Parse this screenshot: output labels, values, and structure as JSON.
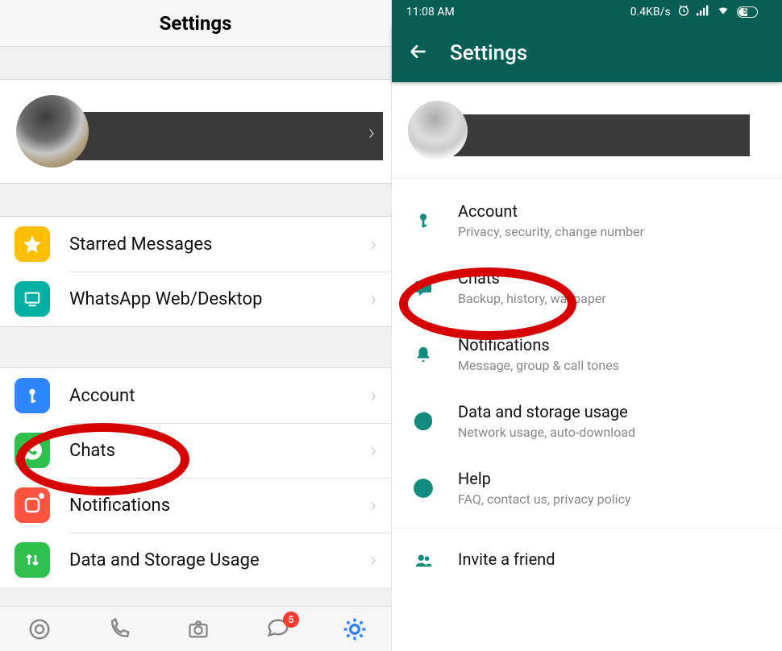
{
  "ios": {
    "title": "Settings",
    "group1": [
      {
        "label": "Starred Messages"
      },
      {
        "label": "WhatsApp Web/Desktop"
      }
    ],
    "group2": [
      {
        "label": "Account"
      },
      {
        "label": "Chats"
      },
      {
        "label": "Notifications"
      },
      {
        "label": "Data and Storage Usage"
      }
    ],
    "tab_badge": "5"
  },
  "android": {
    "status": {
      "time": "11:08 AM",
      "speed": "0.4KB/s",
      "battery": "51"
    },
    "title": "Settings",
    "items": [
      {
        "title": "Account",
        "subtitle": "Privacy, security, change number"
      },
      {
        "title": "Chats",
        "subtitle": "Backup, history, wallpaper"
      },
      {
        "title": "Notifications",
        "subtitle": "Message, group & call tones"
      },
      {
        "title": "Data and storage usage",
        "subtitle": "Network usage, auto-download"
      },
      {
        "title": "Help",
        "subtitle": "FAQ, contact us, privacy policy"
      },
      {
        "title": "Invite a friend",
        "subtitle": ""
      }
    ]
  }
}
